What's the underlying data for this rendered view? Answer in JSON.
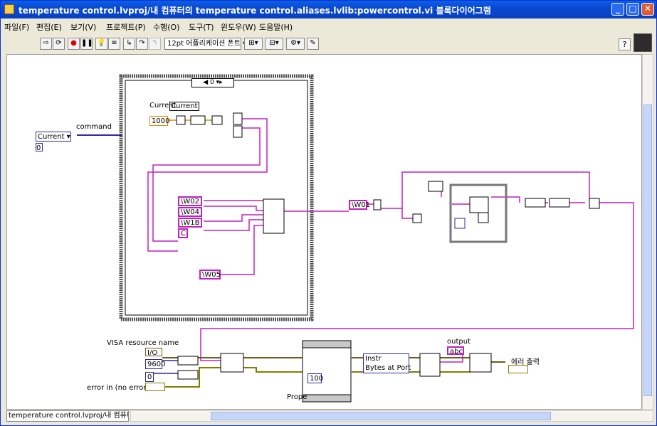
{
  "window": {
    "title": "temperature control.lvproj/내 컴퓨터의 temperature control.aliases.lvlib:powercontrol.vi 블록다이어그램"
  },
  "menu": [
    "파일(F)",
    "편집(E)",
    "보기(V)",
    "프로젝트(P)",
    "수행(O)",
    "도구(T)",
    "윈도우(W)",
    "도움말(H)"
  ],
  "toolbar": {
    "font_select": "12pt 어플리케이션 폰트",
    "help_label": "?"
  },
  "diagram": {
    "case_selector": "◀ 0",
    "command_enum": "Current",
    "command_label": "command",
    "command_num": "0",
    "current_label1": "Current",
    "current_label2": "Current",
    "const_1000": "1000",
    "str_w02": "\\W02",
    "str_w04": "\\W04",
    "str_w1b": "\\W1B",
    "str_c": "C",
    "str_w05": "\\W05",
    "str_w01": "\\W01",
    "visa_resource_label": "VISA resource name",
    "const_9600": "9600",
    "const_0": "0",
    "error_in_label": "error in (no error)",
    "const_100": "100",
    "property_label": "Prope",
    "instr_label": "Instr",
    "bytes_at_port": "Bytes at Port",
    "output_label": "output",
    "error_out_label": "에러 출력"
  },
  "status": {
    "path": "temperature control.lvproj/내 컴퓨터"
  }
}
